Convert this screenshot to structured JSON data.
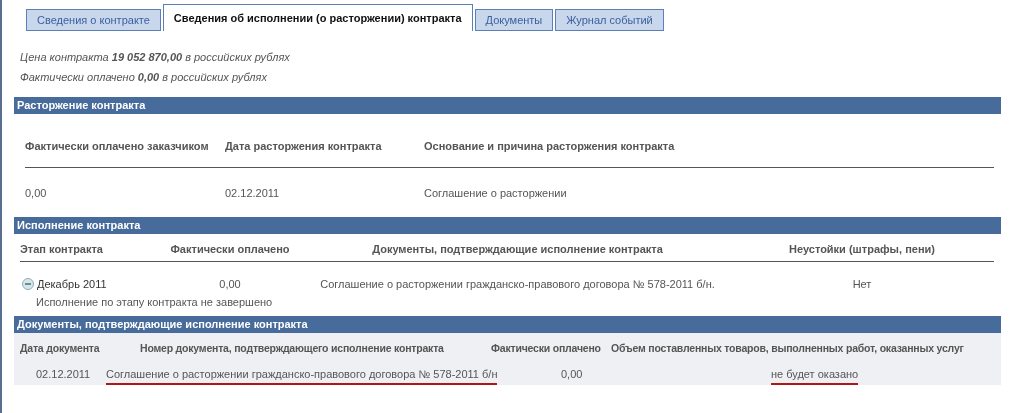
{
  "tabs": [
    {
      "label": "Сведения о контракте",
      "selected": false
    },
    {
      "label": "Сведения об исполнении (о расторжении) контракта",
      "selected": true
    },
    {
      "label": "Документы",
      "selected": false
    },
    {
      "label": "Журнал событий",
      "selected": false
    }
  ],
  "summary": [
    {
      "before": "Цена контракта ",
      "value": "19 052 870,00",
      "after": " в российских рублях"
    },
    {
      "before": "Фактически оплачено ",
      "value": "0,00",
      "after": " в российских рублях"
    }
  ],
  "termination": {
    "title": "Расторжение контракта",
    "columns": [
      "Фактически оплачено заказчиком",
      "Дата расторжения контракта",
      "Основание и причина расторжения контракта"
    ],
    "rows": [
      [
        "0,00",
        "02.12.2011",
        "Соглашение о расторжении"
      ]
    ]
  },
  "execution": {
    "title": "Исполнение контракта",
    "columns": [
      "Этап контракта",
      "Фактически оплачено",
      "Документы, подтверждающие исполнение контракта",
      "Неустойки (штрафы, пени)"
    ],
    "stages": [
      {
        "name": "Декабрь 2011",
        "expanded": true,
        "paid": "0,00",
        "document": "Соглашение о расторжении гражданско-правового договора № 578-2011 б/н.",
        "penalties": "Нет",
        "status": "Исполнение по этапу контракта не завершено"
      }
    ]
  },
  "documents": {
    "title": "Документы, подтверждающие исполнение контракта",
    "columns": [
      "Дата документа",
      "Номер документа, подтверждающего исполнение контракта",
      "Фактически оплачено",
      "Объем поставленных товаров, выполненных работ, оказанных услуг"
    ],
    "rows": [
      {
        "cells": [
          "02.12.2011",
          "Соглашение о расторжении гражданско-правового договора № 578-2011 б/н",
          "0,00",
          "не будет оказано"
        ],
        "underlined": [
          false,
          true,
          false,
          true
        ]
      }
    ]
  }
}
